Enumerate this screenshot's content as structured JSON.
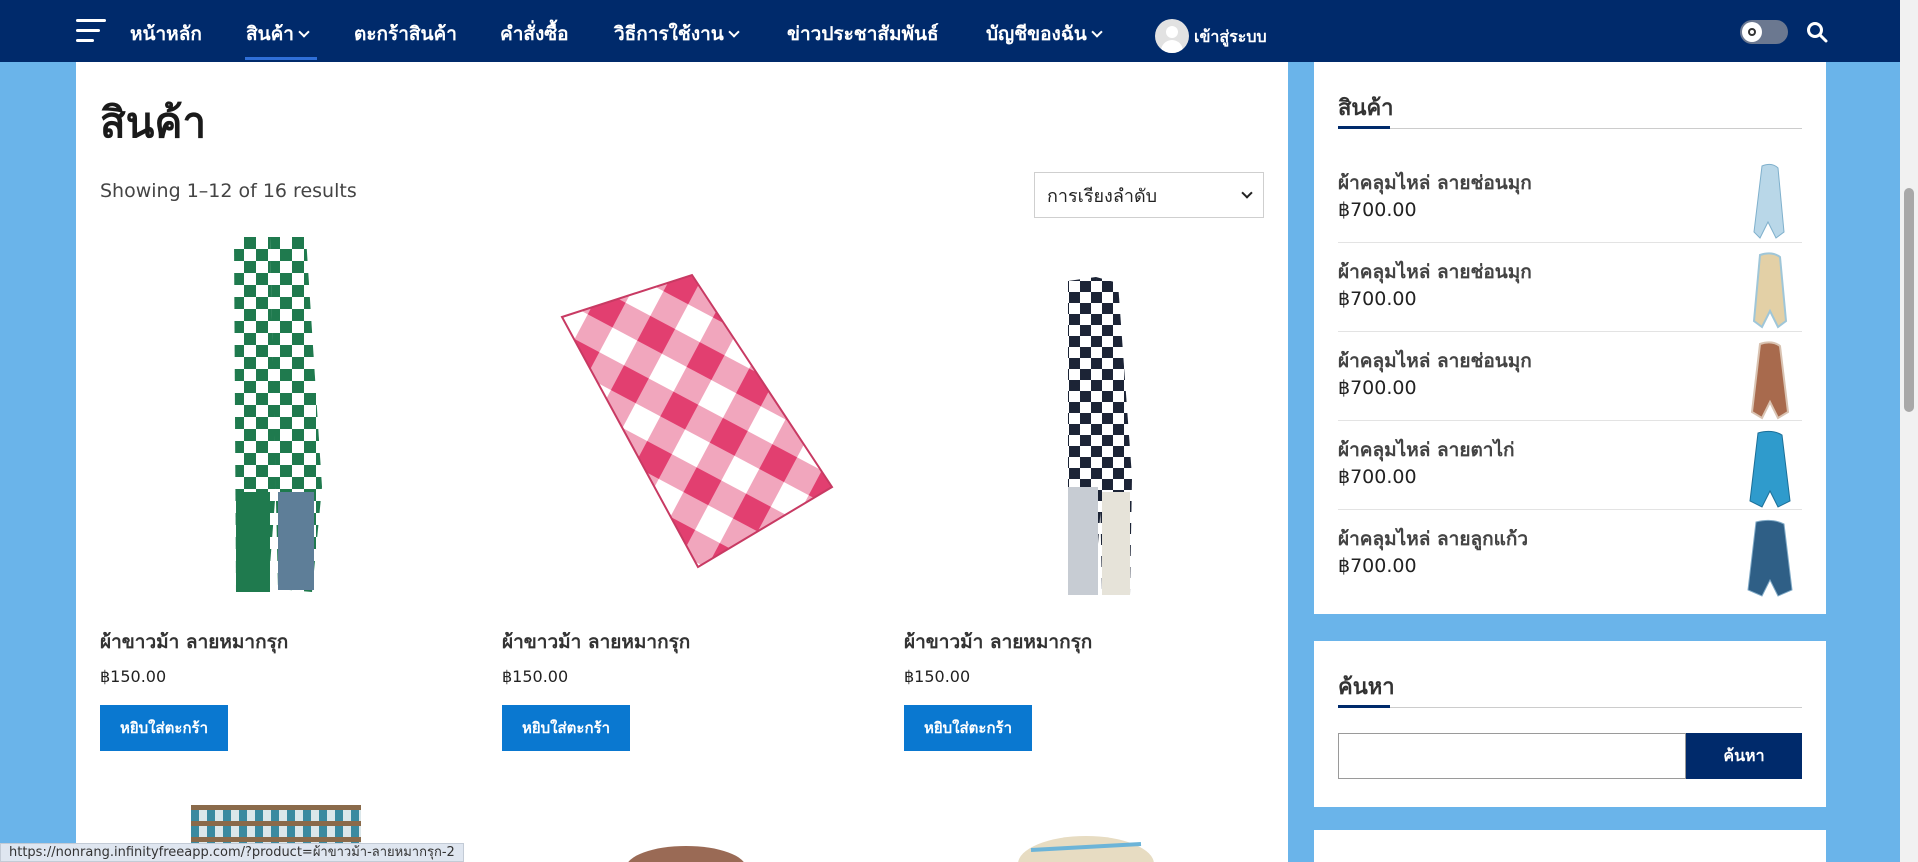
{
  "nav": {
    "items": [
      {
        "label": "หน้าหลัก",
        "dropdown": false
      },
      {
        "label": "สินค้า",
        "dropdown": true
      },
      {
        "label": "ตะกร้าสินค้า",
        "dropdown": false
      },
      {
        "label": "คำสั่งซื้อ",
        "dropdown": false
      },
      {
        "label": "วิธีการใช้งาน",
        "dropdown": true
      },
      {
        "label": "ข่าวประชาสัมพันธ์",
        "dropdown": false
      },
      {
        "label": "บัญชีของฉัน",
        "dropdown": true
      }
    ],
    "login_label": "เข้าสู่ระบบ",
    "icons": [
      "menu-icon",
      "avatar-icon",
      "theme-toggle-icon",
      "search-icon"
    ]
  },
  "main": {
    "title": "สินค้า",
    "result_count": "Showing 1–12 of 16 results",
    "orderby_selected": "การเรียงลำดับ",
    "products": [
      {
        "name": "ผ้าขาวม้า ลายหมากรุก",
        "price": "฿150.00",
        "button": "หยิบใส่ตะกร้า"
      },
      {
        "name": "ผ้าขาวม้า ลายหมากรุก",
        "price": "฿150.00",
        "button": "หยิบใส่ตะกร้า"
      },
      {
        "name": "ผ้าขาวม้า ลายหมากรุก",
        "price": "฿150.00",
        "button": "หยิบใส่ตะกร้า"
      }
    ]
  },
  "sidebar": {
    "products_widget": {
      "title": "สินค้า",
      "items": [
        {
          "name": "ผ้าคลุมไหล่ ลายช่อนมุก",
          "price": "฿700.00",
          "color": "#b9d7e8"
        },
        {
          "name": "ผ้าคลุมไหล่ ลายช่อนมุก",
          "price": "฿700.00",
          "color": "#e3d0a6"
        },
        {
          "name": "ผ้าคลุมไหล่ ลายช่อนมุก",
          "price": "฿700.00",
          "color": "#a86a4d"
        },
        {
          "name": "ผ้าคลุมไหล่ ลายตาไก่",
          "price": "฿700.00",
          "color": "#2f9bcc"
        },
        {
          "name": "ผ้าคลุมไหล่ ลายลูกแก้ว",
          "price": "฿700.00",
          "color": "#2f5f86"
        }
      ]
    },
    "search_widget": {
      "title": "ค้นหา",
      "button": "ค้นหา"
    }
  },
  "status_bar": {
    "url": "https://nonrang.infinityfreeapp.com/?product=ผ้าขาวม้า-ลายหมากรุก-2"
  },
  "colors": {
    "nav_bg": "#002a6b",
    "page_bg": "#6ab4ea",
    "cart_button": "#0a78d0"
  }
}
